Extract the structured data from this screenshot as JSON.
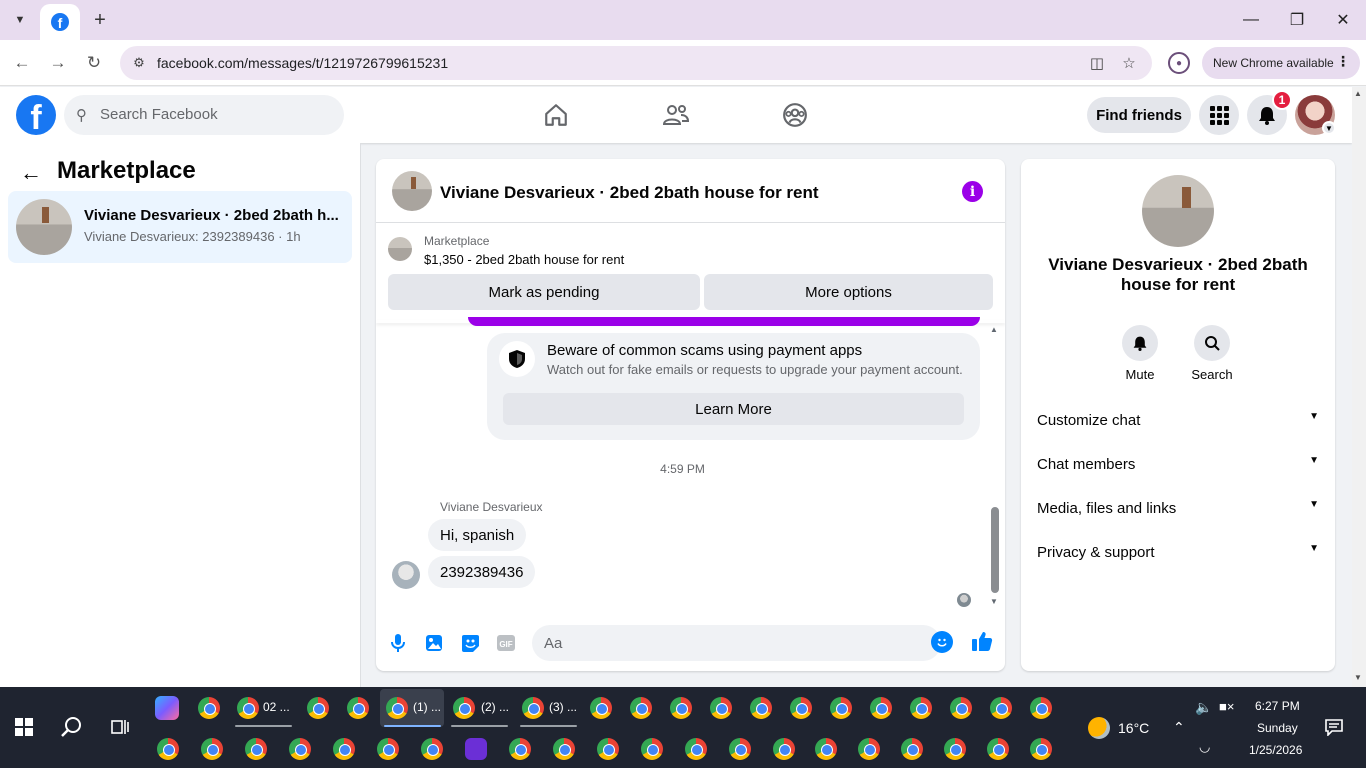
{
  "browser": {
    "url": "facebook.com/messages/t/1219726799615231",
    "new_chrome_label": "New Chrome available"
  },
  "fb_header": {
    "logo": "f",
    "search_placeholder": "Search Facebook",
    "find_friends": "Find friends",
    "notification_count": "1"
  },
  "sidebar": {
    "title": "Marketplace",
    "conversation": {
      "name": "Viviane Desvarieux · 2bed 2bath h...",
      "preview": "Viviane Desvarieux: 2392389436 · 1h"
    }
  },
  "chat": {
    "title": "Viviane Desvarieux · 2bed 2bath house for rent",
    "listing_label": "Marketplace",
    "listing_price": "$1,350 - 2bed 2bath house for rent",
    "mark_pending": "Mark as pending",
    "more_options": "More options",
    "scam_title": "Beware of common scams using payment apps",
    "scam_subtitle": "Watch out for fake emails or requests to upgrade your payment account.",
    "learn_more": "Learn More",
    "timestamp": "4:59 PM",
    "sender": "Viviane Desvarieux",
    "messages": [
      "Hi, spanish",
      "2392389436"
    ],
    "input_placeholder": "Aa"
  },
  "details": {
    "name": "Viviane Desvarieux · 2bed 2bath house for rent",
    "mute": "Mute",
    "search": "Search",
    "rows": [
      "Customize chat",
      "Chat members",
      "Media, files and links",
      "Privacy & support"
    ]
  },
  "taskbar": {
    "items_row1": [
      "02 ...",
      "(1) ...",
      "(2) ...",
      "(3) ..."
    ],
    "weather": "16°C",
    "time": "6:27 PM",
    "day": "Sunday",
    "date": "1/25/2026"
  },
  "colors": {
    "fb_blue": "#1877f2",
    "messenger_purple": "#9b00e8",
    "selected_bg": "#ebf5ff"
  }
}
